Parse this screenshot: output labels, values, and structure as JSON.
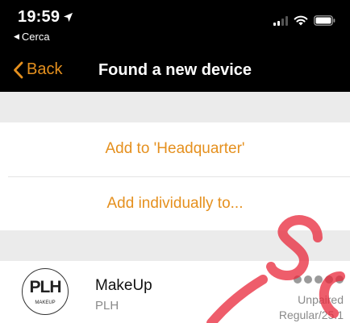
{
  "status_bar": {
    "time": "19:59",
    "back_app": "Cerca",
    "icons": [
      "location-arrow-icon",
      "signal-icon",
      "wifi-icon",
      "battery-icon"
    ]
  },
  "nav": {
    "back_label": "Back",
    "title": "Found a new device"
  },
  "actions": {
    "add_to_group": "Add to 'Headquarter'",
    "add_individually": "Add individually to..."
  },
  "device": {
    "icon_logo": "PLH",
    "icon_caption": "MAKEUP",
    "name": "MakeUp",
    "brand": "PLH",
    "signal_level": 5,
    "status": "Unpaired",
    "detail": "Regular/25.1"
  },
  "colors": {
    "accent": "#e5901e",
    "watermark": "#e8273a",
    "background": "#ebebeb"
  }
}
